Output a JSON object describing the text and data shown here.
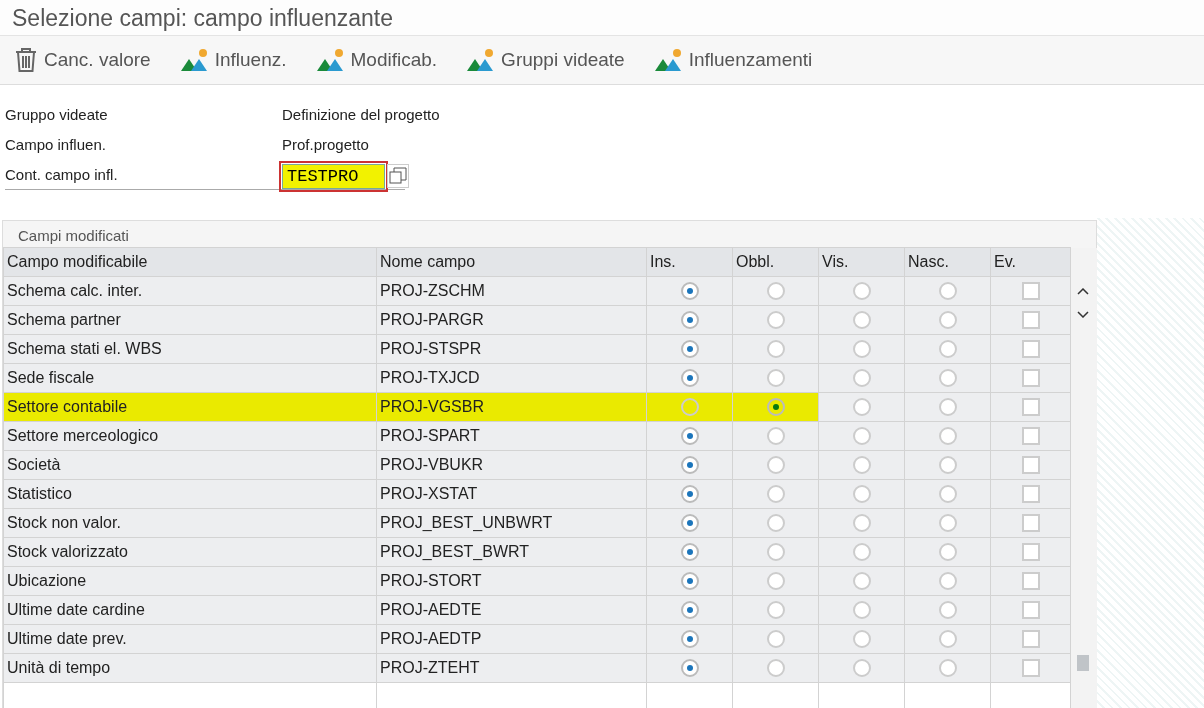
{
  "window": {
    "title": "Selezione campi: campo influenzante"
  },
  "toolbar": [
    {
      "kind": "trash",
      "label": "Canc. valore"
    },
    {
      "kind": "mountain",
      "label": "Influenz."
    },
    {
      "kind": "mountain",
      "label": "Modificab."
    },
    {
      "kind": "mountain",
      "label": "Gruppi videate"
    },
    {
      "kind": "mountain",
      "label": "Influenzamenti"
    }
  ],
  "form": {
    "fields": [
      {
        "kind": "text",
        "label": "Gruppo videate",
        "value": "Definizione del progetto"
      },
      {
        "kind": "text",
        "label": "Campo influen.",
        "value": "Prof.progetto"
      },
      {
        "kind": "input",
        "label": "Cont. campo infl.",
        "value": "TESTPRO",
        "highlighted": true
      }
    ]
  },
  "table": {
    "title": "Campi modificati",
    "columns": [
      "Campo modificabile",
      "Nome campo",
      "Ins.",
      "Obbl.",
      "Vis.",
      "Nasc.",
      "Ev."
    ],
    "rows": [
      {
        "field": "Schema calc. inter.",
        "name": "PROJ-ZSCHM",
        "highlighted": false,
        "options": [
          {
            "selected": true
          },
          {
            "selected": false
          },
          {
            "selected": false
          },
          {
            "selected": false
          }
        ],
        "ev": {
          "checked": false
        }
      },
      {
        "field": "Schema partner",
        "name": "PROJ-PARGR",
        "highlighted": false,
        "options": [
          {
            "selected": true
          },
          {
            "selected": false
          },
          {
            "selected": false
          },
          {
            "selected": false
          }
        ],
        "ev": {
          "checked": false
        }
      },
      {
        "field": "Schema stati el. WBS",
        "name": "PROJ-STSPR",
        "highlighted": false,
        "options": [
          {
            "selected": true
          },
          {
            "selected": false
          },
          {
            "selected": false
          },
          {
            "selected": false
          }
        ],
        "ev": {
          "checked": false
        }
      },
      {
        "field": "Sede fiscale",
        "name": "PROJ-TXJCD",
        "highlighted": false,
        "options": [
          {
            "selected": true
          },
          {
            "selected": false
          },
          {
            "selected": false
          },
          {
            "selected": false
          }
        ],
        "ev": {
          "checked": false
        }
      },
      {
        "field": "Settore contabile",
        "name": "PROJ-VGSBR",
        "highlighted": true,
        "options": [
          {
            "selected": false
          },
          {
            "selected": true
          },
          {
            "selected": false
          },
          {
            "selected": false
          }
        ],
        "ev": {
          "checked": false
        }
      },
      {
        "field": "Settore merceologico",
        "name": "PROJ-SPART",
        "highlighted": false,
        "options": [
          {
            "selected": true
          },
          {
            "selected": false
          },
          {
            "selected": false
          },
          {
            "selected": false
          }
        ],
        "ev": {
          "checked": false
        }
      },
      {
        "field": "Società",
        "name": "PROJ-VBUKR",
        "highlighted": false,
        "options": [
          {
            "selected": true
          },
          {
            "selected": false
          },
          {
            "selected": false
          },
          {
            "selected": false
          }
        ],
        "ev": {
          "checked": false
        }
      },
      {
        "field": "Statistico",
        "name": "PROJ-XSTAT",
        "highlighted": false,
        "options": [
          {
            "selected": true
          },
          {
            "selected": false
          },
          {
            "selected": false
          },
          {
            "selected": false
          }
        ],
        "ev": {
          "checked": false
        }
      },
      {
        "field": "Stock non valor.",
        "name": "PROJ_BEST_UNBWRT",
        "highlighted": false,
        "options": [
          {
            "selected": true
          },
          {
            "selected": false
          },
          {
            "selected": false
          },
          {
            "selected": false
          }
        ],
        "ev": {
          "checked": false
        }
      },
      {
        "field": "Stock valorizzato",
        "name": "PROJ_BEST_BWRT",
        "highlighted": false,
        "options": [
          {
            "selected": true
          },
          {
            "selected": false
          },
          {
            "selected": false
          },
          {
            "selected": false
          }
        ],
        "ev": {
          "checked": false
        }
      },
      {
        "field": "Ubicazione",
        "name": "PROJ-STORT",
        "highlighted": false,
        "options": [
          {
            "selected": true
          },
          {
            "selected": false
          },
          {
            "selected": false
          },
          {
            "selected": false
          }
        ],
        "ev": {
          "checked": false
        }
      },
      {
        "field": "Ultime date cardine",
        "name": "PROJ-AEDTE",
        "highlighted": false,
        "options": [
          {
            "selected": true
          },
          {
            "selected": false
          },
          {
            "selected": false
          },
          {
            "selected": false
          }
        ],
        "ev": {
          "checked": false
        }
      },
      {
        "field": "Ultime date prev.",
        "name": "PROJ-AEDTP",
        "highlighted": false,
        "options": [
          {
            "selected": true
          },
          {
            "selected": false
          },
          {
            "selected": false
          },
          {
            "selected": false
          }
        ],
        "ev": {
          "checked": false
        }
      },
      {
        "field": "Unità di tempo",
        "name": "PROJ-ZTEHT",
        "highlighted": false,
        "options": [
          {
            "selected": true
          },
          {
            "selected": false
          },
          {
            "selected": false
          },
          {
            "selected": false
          }
        ],
        "ev": {
          "checked": false
        }
      }
    ]
  }
}
